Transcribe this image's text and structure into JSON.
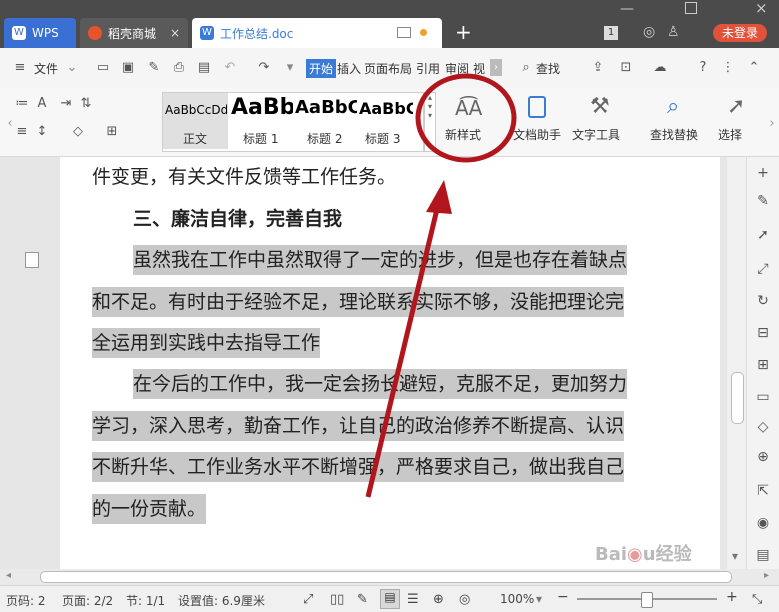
{
  "titlebar": {
    "tabs": [
      {
        "label": "WPS",
        "icon": "wps-logo-icon"
      },
      {
        "label": "稻壳商城",
        "icon": "docer-icon"
      },
      {
        "label": "工作总结.doc",
        "icon": "word-doc-icon"
      }
    ],
    "page_count_badge": "1",
    "login_button": "未登录"
  },
  "menubar": {
    "file_label": "文件",
    "tabs": [
      "开始",
      "插入",
      "页面布局",
      "引用",
      "审阅",
      "视"
    ],
    "search_label": "查找"
  },
  "ribbon": {
    "styles": [
      {
        "sample": "AaBbCcDd",
        "label": "正文"
      },
      {
        "sample": "AaBb",
        "label": "标题 1"
      },
      {
        "sample": "AaBbC",
        "label": "标题 2"
      },
      {
        "sample": "AaBbC",
        "label": "标题 3"
      }
    ],
    "new_style_label": "新样式",
    "doc_helper_label": "文档助手",
    "text_tools_label": "文字工具",
    "find_replace_label": "查找替换",
    "select_label": "选择"
  },
  "document": {
    "lines": [
      "件变更，有关文件反馈等工作任务。",
      "三、廉洁自律，完善自我",
      "虽然我在工作中虽然取得了一定的进步，但是也存在着缺点",
      "和不足。有时由于经验不足，理论联系实际不够，没能把理论完",
      "全运用到实践中去指导工作",
      "在今后的工作中，我一定会扬长避短，克服不足，更加努力",
      "学习，深入思考，勤奋工作，让自己的政治修养不断提高、认识",
      "不断升华、工作业务水平不断增强，严格要求自己，做出我自己",
      "的一份贡献。"
    ]
  },
  "statusbar": {
    "page_num": "页码: 2",
    "pages": "页面: 2/2",
    "section": "节: 1/1",
    "setting": "设置值: 6.9厘米",
    "zoom": "100%"
  },
  "watermark": "Baidu经验 jingyan.baidu.com"
}
